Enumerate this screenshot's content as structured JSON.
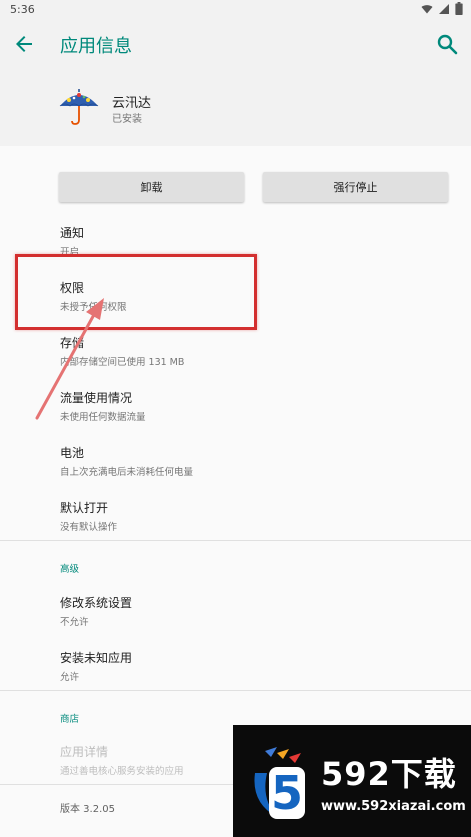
{
  "status_bar": {
    "time": "5:36",
    "icons": [
      "wifi-icon",
      "cellular-icon",
      "battery-icon"
    ]
  },
  "app_bar": {
    "title": "应用信息",
    "back_icon": "back-arrow-icon",
    "search_icon": "search-icon"
  },
  "app": {
    "name": "云汛达",
    "status": "已安装",
    "icon": "umbrella-app-icon"
  },
  "buttons": {
    "uninstall": "卸载",
    "force_stop": "强行停止"
  },
  "items": [
    {
      "title": "通知",
      "subtitle": "开启"
    },
    {
      "title": "权限",
      "subtitle": "未授予任何权限"
    },
    {
      "title": "存储",
      "subtitle": "内部存储空间已使用 131 MB"
    },
    {
      "title": "流量使用情况",
      "subtitle": "未使用任何数据流量"
    },
    {
      "title": "电池",
      "subtitle": "自上次充满电后未消耗任何电量"
    },
    {
      "title": "默认打开",
      "subtitle": "没有默认操作"
    }
  ],
  "advanced": {
    "header": "高级",
    "items": [
      {
        "title": "修改系统设置",
        "subtitle": "不允许"
      },
      {
        "title": "安装未知应用",
        "subtitle": "允许"
      }
    ]
  },
  "store": {
    "header": "商店",
    "details": {
      "title": "应用详情",
      "subtitle": "通过善电核心服务安装的应用"
    }
  },
  "version": "版本 3.2.05",
  "watermark": {
    "brand": "592下载",
    "url": "www.592xiazai.com",
    "logo_digit": "5"
  },
  "colors": {
    "accent": "#00897b",
    "highlight": "#d32f2f",
    "annotation_arrow": "#e57373"
  }
}
